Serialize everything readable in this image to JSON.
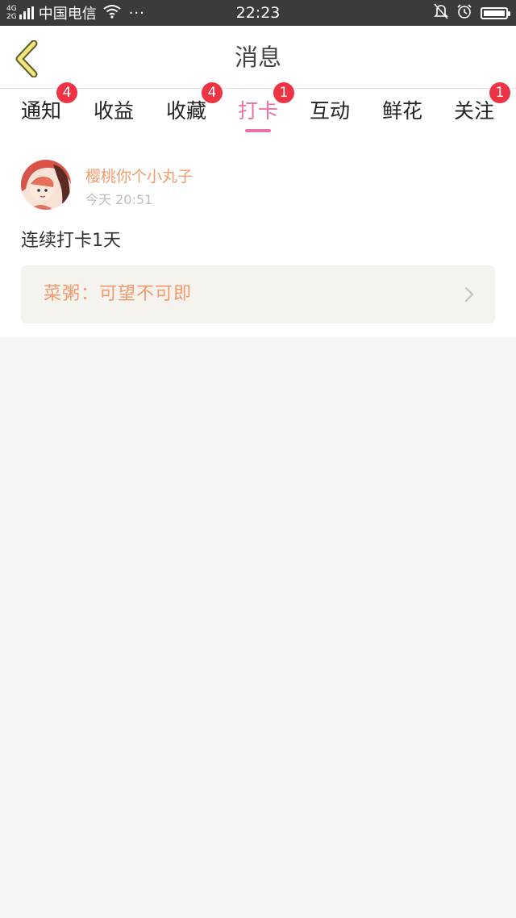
{
  "status_bar": {
    "network_top": "4G",
    "network_bottom": "2G",
    "carrier": "中国电信",
    "more": "···",
    "time": "22:23",
    "battery_level": 1.0
  },
  "navbar": {
    "title": "消息"
  },
  "tabs": [
    {
      "label": "通知",
      "badge": "4"
    },
    {
      "label": "收益",
      "badge": ""
    },
    {
      "label": "收藏",
      "badge": "4"
    },
    {
      "label": "打卡",
      "badge": "1",
      "active": true
    },
    {
      "label": "互动",
      "badge": ""
    },
    {
      "label": "鲜花",
      "badge": ""
    },
    {
      "label": "关注",
      "badge": "1"
    }
  ],
  "message": {
    "username": "樱桃你个小丸子",
    "time": "今天 20:51",
    "text": "连续打卡1天",
    "link_text": "菜粥：可望不可即"
  },
  "colors": {
    "accent": "#e872a8",
    "badge": "#ee3344",
    "username": "#f39a6c"
  }
}
